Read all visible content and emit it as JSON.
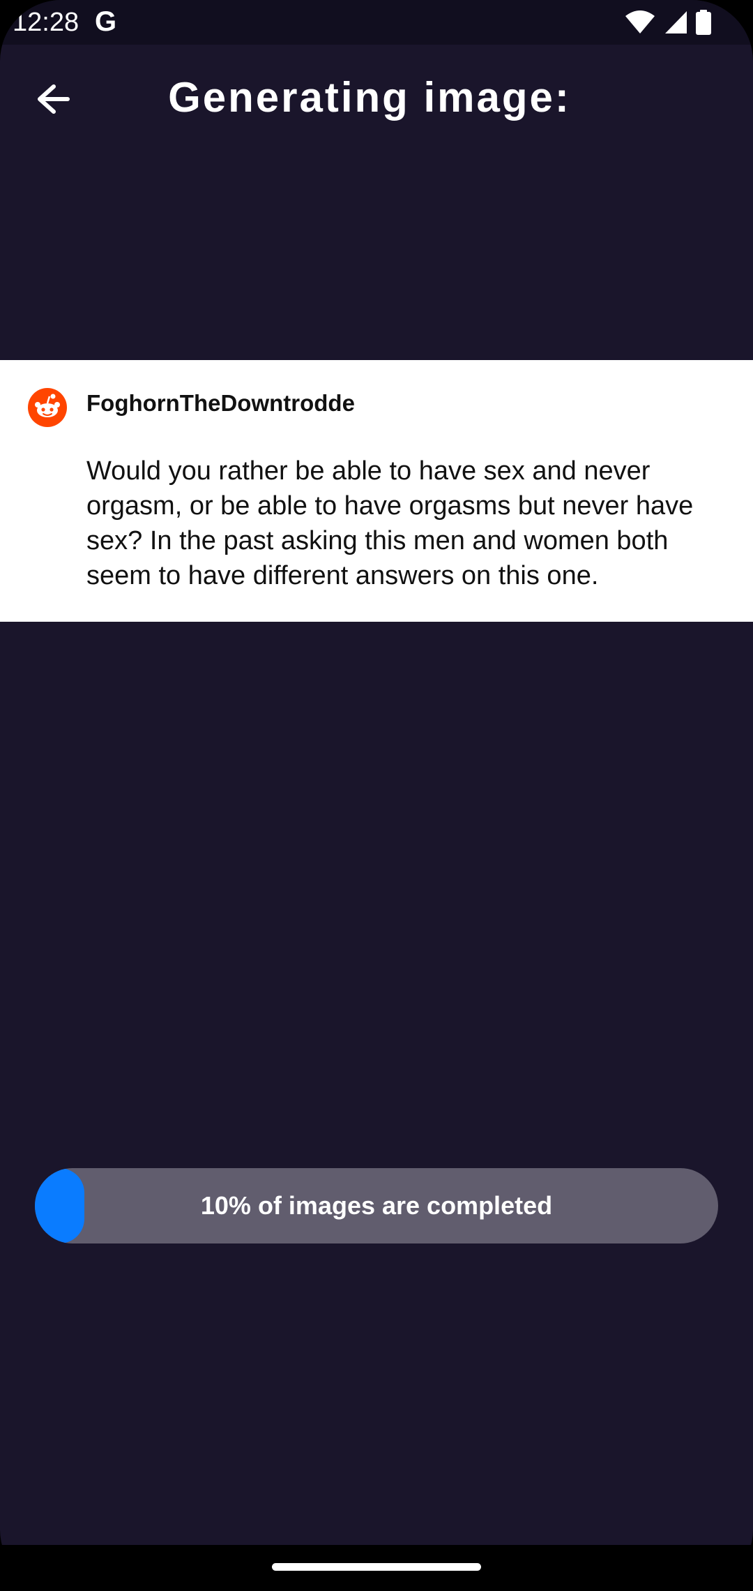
{
  "status_bar": {
    "time": "12:28",
    "google_badge": "G",
    "icons": [
      "wifi-icon",
      "signal-icon",
      "battery-icon"
    ]
  },
  "header": {
    "title": "Generating image:",
    "back_icon": "arrow-left-icon"
  },
  "post": {
    "username": "FoghornTheDowntrodde",
    "avatar_icon": "reddit-icon",
    "body": "Would you rather be able to have sex and never orgasm, or be able to have orgasms but never have sex? In the past asking this men and women both seem to have different answers on this one."
  },
  "progress": {
    "label": "10% of images are completed",
    "fraction": 0.07
  },
  "colors": {
    "background": "#1a152b",
    "status_bar": "#110e1f",
    "card": "#ffffff",
    "progress_track": "#615d6e",
    "progress_fill": "#0a7cff",
    "reddit_orange": "#ff4500"
  }
}
